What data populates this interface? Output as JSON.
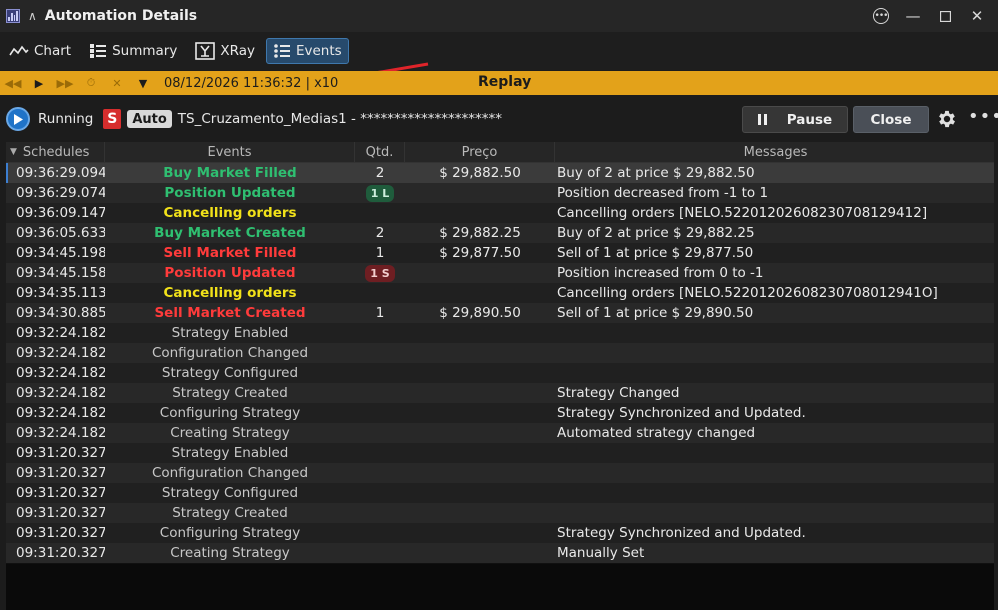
{
  "window": {
    "title": "Automation Details"
  },
  "tabs": [
    {
      "label": "Chart",
      "icon": "line-chart-icon",
      "active": false
    },
    {
      "label": "Summary",
      "icon": "summary-list-icon",
      "active": false
    },
    {
      "label": "XRay",
      "icon": "xray-icon",
      "active": false
    },
    {
      "label": "Events",
      "icon": "events-list-icon",
      "active": true
    }
  ],
  "replay": {
    "datetime": "08/12/2026 11:36:32 | x10",
    "label": "Replay",
    "bar_color": "#e3a21a"
  },
  "status": {
    "state": "Running",
    "badge_s": "S",
    "badge_auto": "Auto",
    "strategy": "TS_Cruzamento_Medias1 - *********************"
  },
  "buttons": {
    "pause": "Pause",
    "close": "Close"
  },
  "table": {
    "headers": {
      "schedules": "Schedules",
      "events": "Events",
      "qtd": "Qtd.",
      "price": "Preço",
      "messages": "Messages"
    },
    "rows": [
      {
        "time": "09:36:29.094",
        "event": "Buy Market Filled",
        "style": "green",
        "qtd": "2",
        "price": "$ 29,882.50",
        "message": "Buy of 2 at price $ 29,882.50",
        "selected": true
      },
      {
        "time": "09:36:29.074",
        "event": "Position Updated",
        "style": "green",
        "pill": "1 L",
        "pill_style": "green",
        "qtd": "",
        "price": "",
        "message": "Position decreased from -1 to 1"
      },
      {
        "time": "09:36:09.147",
        "event": "Cancelling orders",
        "style": "yellow",
        "qtd": "",
        "price": "",
        "message": "Cancelling orders [NELO.52201202608230708129412]"
      },
      {
        "time": "09:36:05.633",
        "event": "Buy Market Created",
        "style": "green",
        "qtd": "2",
        "price": "$ 29,882.25",
        "message": "Buy of 2 at price $ 29,882.25"
      },
      {
        "time": "09:34:45.198",
        "event": "Sell Market Filled",
        "style": "red",
        "qtd": "1",
        "price": "$ 29,877.50",
        "message": "Sell of 1 at price $ 29,877.50"
      },
      {
        "time": "09:34:45.158",
        "event": "Position Updated",
        "style": "red",
        "pill": "1 S",
        "pill_style": "red",
        "qtd": "",
        "price": "",
        "message": "Position increased from 0 to -1"
      },
      {
        "time": "09:34:35.113",
        "event": "Cancelling orders",
        "style": "yellow",
        "qtd": "",
        "price": "",
        "message": "Cancelling orders [NELO.52201202608230708012941O]"
      },
      {
        "time": "09:34:30.885",
        "event": "Sell Market Created",
        "style": "red",
        "qtd": "1",
        "price": "$ 29,890.50",
        "message": "Sell of 1 at price $ 29,890.50"
      },
      {
        "time": "09:32:24.182",
        "event": "Strategy Enabled",
        "style": "",
        "qtd": "",
        "price": "",
        "message": ""
      },
      {
        "time": "09:32:24.182",
        "event": "Configuration Changed",
        "style": "",
        "qtd": "",
        "price": "",
        "message": ""
      },
      {
        "time": "09:32:24.182",
        "event": "Strategy Configured",
        "style": "",
        "qtd": "",
        "price": "",
        "message": ""
      },
      {
        "time": "09:32:24.182",
        "event": "Strategy Created",
        "style": "",
        "qtd": "",
        "price": "",
        "message": "Strategy Changed"
      },
      {
        "time": "09:32:24.182",
        "event": "Configuring Strategy",
        "style": "",
        "qtd": "",
        "price": "",
        "message": "Strategy Synchronized and Updated."
      },
      {
        "time": "09:32:24.182",
        "event": "Creating Strategy",
        "style": "",
        "qtd": "",
        "price": "",
        "message": "Automated strategy changed"
      },
      {
        "time": "09:31:20.327",
        "event": "Strategy Enabled",
        "style": "",
        "qtd": "",
        "price": "",
        "message": ""
      },
      {
        "time": "09:31:20.327",
        "event": "Configuration Changed",
        "style": "",
        "qtd": "",
        "price": "",
        "message": ""
      },
      {
        "time": "09:31:20.327",
        "event": "Strategy Configured",
        "style": "",
        "qtd": "",
        "price": "",
        "message": ""
      },
      {
        "time": "09:31:20.327",
        "event": "Strategy Created",
        "style": "",
        "qtd": "",
        "price": "",
        "message": ""
      },
      {
        "time": "09:31:20.327",
        "event": "Configuring Strategy",
        "style": "",
        "qtd": "",
        "price": "",
        "message": "Strategy Synchronized and Updated."
      },
      {
        "time": "09:31:20.327",
        "event": "Creating Strategy",
        "style": "",
        "qtd": "",
        "price": "",
        "message": "Manually Set"
      }
    ]
  }
}
